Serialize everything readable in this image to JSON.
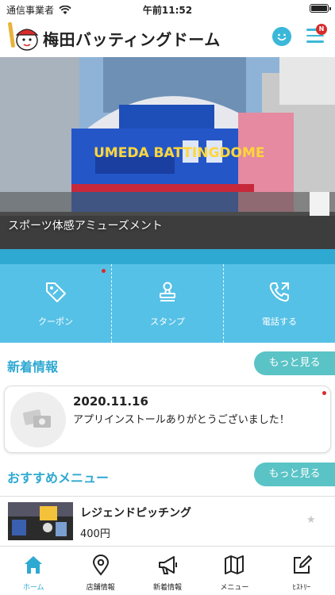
{
  "status_bar": {
    "carrier": "通信事業者",
    "time": "午前11:52"
  },
  "header": {
    "title": "梅田バッティングドーム",
    "notification_badge": "N"
  },
  "hero": {
    "caption": "スポーツ体感アミューズメント",
    "sign_text": "UMEDA BATTINGDOME"
  },
  "actions": [
    {
      "label": "クーポン",
      "icon": "coupon-tag-icon"
    },
    {
      "label": "スタンプ",
      "icon": "stamp-icon"
    },
    {
      "label": "電話する",
      "icon": "phone-icon"
    }
  ],
  "news": {
    "title": "新着情報",
    "more_label": "もっと見る",
    "items": [
      {
        "date": "2020.11.16",
        "text": "アプリインストールありがとうございました！"
      }
    ]
  },
  "recommend": {
    "title": "おすすめメニュー",
    "more_label": "もっと見る",
    "items": [
      {
        "name": "レジェンドピッチング",
        "price": "400円"
      }
    ]
  },
  "tabbar": [
    {
      "label": "ホーム",
      "icon": "home-icon",
      "active": true
    },
    {
      "label": "店舗情報",
      "icon": "map-pin-icon",
      "active": false
    },
    {
      "label": "新着情報",
      "icon": "megaphone-icon",
      "active": false
    },
    {
      "label": "メニュー",
      "icon": "map-icon",
      "active": false
    },
    {
      "label": "ﾋｽﾄﾘｰ",
      "icon": "edit-icon",
      "active": false
    }
  ],
  "colors": {
    "accent": "#2ea9d2",
    "action_panel": "#56c1e6",
    "more_button": "#5ac3c6",
    "badge": "#d82c2c"
  }
}
